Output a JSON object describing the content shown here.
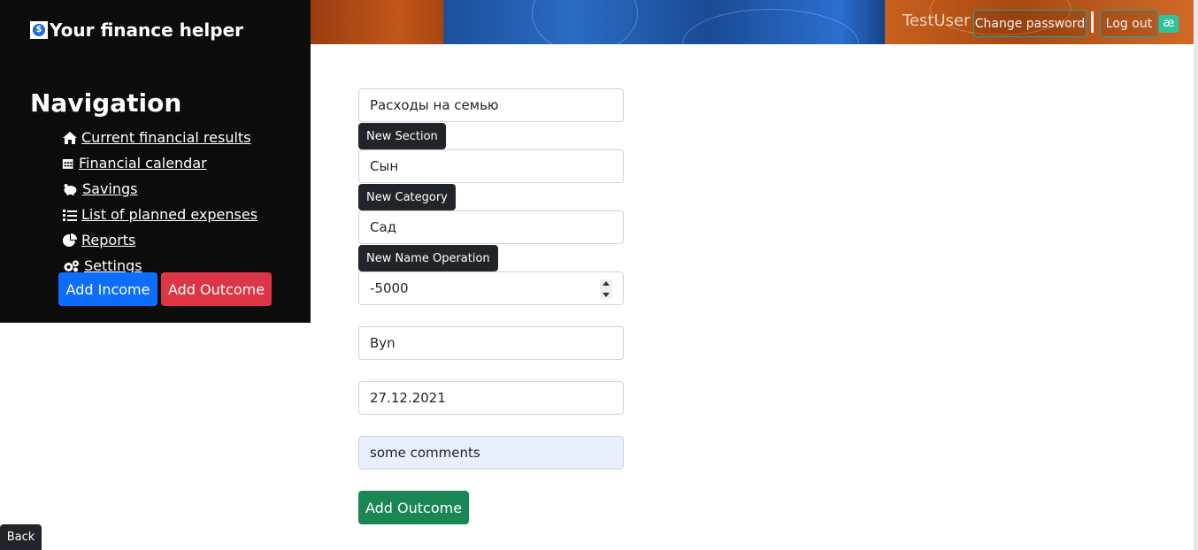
{
  "brand": {
    "title": "Your finance helper",
    "icon": "dollar-coin-icon"
  },
  "nav": {
    "title": "Navigation",
    "items": [
      {
        "label": "Current financial results",
        "icon": "home-icon"
      },
      {
        "label": "Financial calendar",
        "icon": "calendar-icon"
      },
      {
        "label": "Savings",
        "icon": "piggy-bank-icon"
      },
      {
        "label": "List of planned expenses",
        "icon": "list-icon"
      },
      {
        "label": "Reports",
        "icon": "pie-chart-icon"
      },
      {
        "label": "Settings",
        "icon": "gears-icon"
      }
    ],
    "add_income": "Add Income",
    "add_outcome": "Add Outcome"
  },
  "user": {
    "name": "TestUser",
    "change_password": "Change password",
    "log_out": "Log out",
    "ext_icon": "æ"
  },
  "form": {
    "section_value": "Расходы на семью",
    "section_tooltip": "New Section",
    "category_value": "Сын",
    "category_tooltip": "New Category",
    "operation_value": "Сад",
    "operation_tooltip": "New Name Operation",
    "amount_value": "-5000",
    "currency_value": "Byn",
    "date_value": "27.12.2021",
    "comment_value": "some comments",
    "submit": "Add Outcome"
  },
  "footer": {
    "back": "Back"
  },
  "colors": {
    "primary": "#0d6efd",
    "danger": "#dc3545",
    "success": "#198754",
    "sidebar_bg": "#0c0c0c",
    "tooltip_bg": "#212529"
  }
}
